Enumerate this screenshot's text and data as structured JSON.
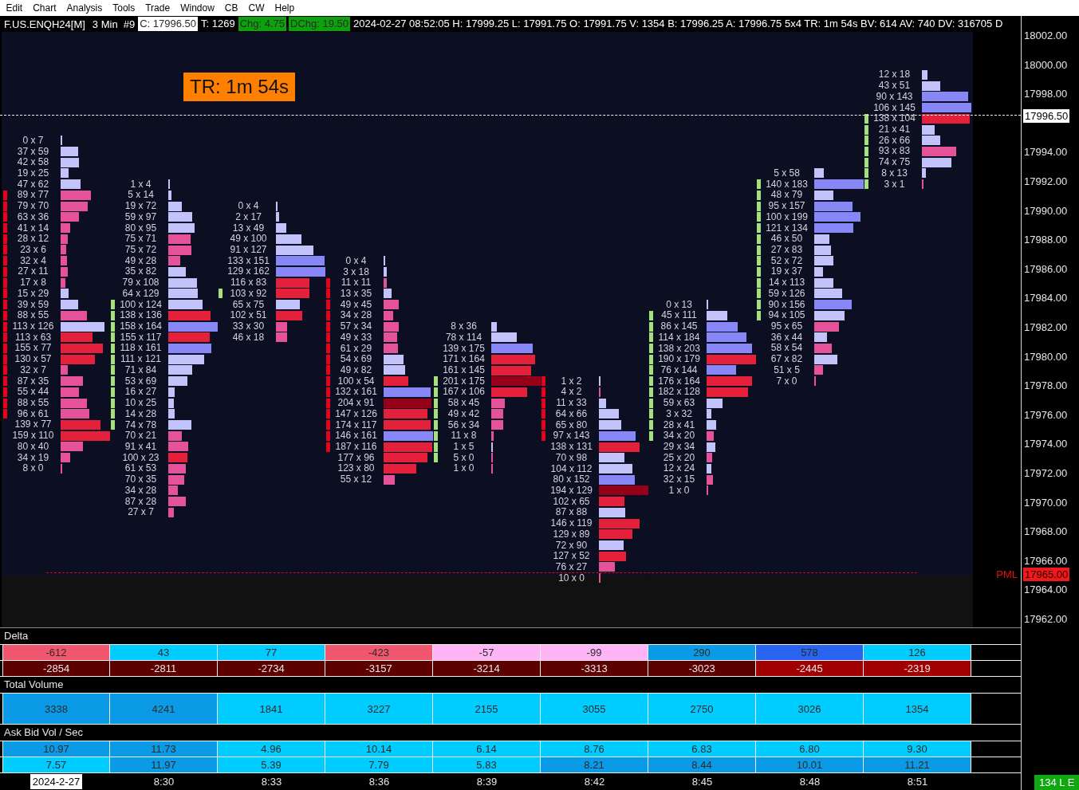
{
  "menu_bar": [
    "Edit",
    "Chart",
    "Analysis",
    "Tools",
    "Trade",
    "Window",
    "CB",
    "CW",
    "Help"
  ],
  "info_bar": {
    "symbol": "F.US.ENQH24[M]",
    "interval": "3 Min",
    "bar_number": "#9",
    "fields": [
      {
        "text": "C: 17996.50",
        "color": "#ffffff"
      },
      {
        "text": "T: 1269"
      },
      {
        "text": "Chg: 4.75",
        "color": "#0ca20c"
      },
      {
        "text": "DChg: 19.50",
        "color": "#0ca20c"
      },
      {
        "text": "2024-02-27 08:52:05 H: 17999.25 L: 17991.75 O: 17991.75 V: 1354 B: 17996.25 A: 17996.75 5x4 TR: 1m 54s BV: 614 AV: 740 DV: 316705 D"
      }
    ]
  },
  "timer_badge": "TR: 1m 54s",
  "footprint_columns": [
    {
      "rows": [
        {
          "text": "0 x 7",
          "color": "#c3c3fb",
          "level": 0.03
        },
        {
          "text": "37 x 59",
          "color": "#c3c3fb",
          "level": 0.36
        },
        {
          "text": "42 x 58",
          "color": "#c3c3fb",
          "level": 0.37
        },
        {
          "text": "19 x 25",
          "color": "#c3c3fb",
          "level": 0.16
        },
        {
          "text": "47 x 62",
          "color": "#c3c3fb",
          "level": 0.41
        },
        {
          "text": "89 x 77",
          "color": "#e6529a",
          "level": 0.62,
          "strip": {
            "color": "#e8001c"
          }
        },
        {
          "text": "79 x 70",
          "color": "#e6529a",
          "level": 0.55,
          "strip": {
            "color": "#e8001c"
          }
        },
        {
          "text": "63 x 36",
          "color": "#e6529a",
          "level": 0.37,
          "strip": {
            "color": "#e8001c"
          }
        },
        {
          "text": "41 x 14",
          "color": "#e6529a",
          "level": 0.2,
          "strip": {
            "color": "#e8001c"
          }
        },
        {
          "text": "28 x 12",
          "color": "#e6529a",
          "level": 0.15,
          "strip": {
            "color": "#e8001c"
          }
        },
        {
          "text": "23 x 6",
          "color": "#e6529a",
          "level": 0.11,
          "strip": {
            "color": "#e8001c"
          }
        },
        {
          "text": "32 x 4",
          "color": "#e6529a",
          "level": 0.13,
          "strip": {
            "color": "#e8001c"
          }
        },
        {
          "text": "27 x 11",
          "color": "#e6529a",
          "level": 0.14,
          "strip": {
            "color": "#e8001c"
          }
        },
        {
          "text": "17 x 8",
          "color": "#e6529a",
          "level": 0.09,
          "strip": {
            "color": "#e8001c"
          }
        },
        {
          "text": "15 x 29",
          "color": "#c3c3fb",
          "level": 0.16,
          "strip": {
            "color": "#e8001c"
          }
        },
        {
          "text": "39 x 59",
          "color": "#c3c3fb",
          "level": 0.36,
          "strip": {
            "color": "#e8001c"
          }
        },
        {
          "text": "88 x 55",
          "color": "#e6529a",
          "level": 0.53,
          "strip": {
            "color": "#e8001c"
          }
        },
        {
          "text": "113 x 126",
          "color": "#c3c3fb",
          "level": 0.89,
          "strip": {
            "color": "#e8001c"
          }
        },
        {
          "text": "113 x 63",
          "color": "#e5203a",
          "level": 0.65,
          "strip": {
            "color": "#e8001c"
          }
        },
        {
          "text": "155 x 77",
          "color": "#e5203a",
          "level": 0.86,
          "strip": {
            "color": "#e8001c"
          }
        },
        {
          "text": "130 x 57",
          "color": "#e5203a",
          "level": 0.7,
          "strip": {
            "color": "#e8001c"
          }
        },
        {
          "text": "32 x 7",
          "color": "#e6529a",
          "level": 0.14,
          "strip": {
            "color": "#e8001c"
          }
        },
        {
          "text": "87 x 35",
          "color": "#e6529a",
          "level": 0.45,
          "strip": {
            "color": "#e8001c"
          }
        },
        {
          "text": "55 x 44",
          "color": "#e6529a",
          "level": 0.37,
          "strip": {
            "color": "#e8001c"
          }
        },
        {
          "text": "88 x 55",
          "color": "#e6529a",
          "level": 0.53,
          "strip": {
            "color": "#e8001c"
          }
        },
        {
          "text": "96 x 61",
          "color": "#e6529a",
          "level": 0.58,
          "strip": {
            "color": "#e8001c"
          }
        },
        {
          "text": "139 x 77",
          "color": "#e5203a",
          "level": 0.8
        },
        {
          "text": "159 x 110",
          "color": "#e5203a",
          "level": 1.0
        },
        {
          "text": "80 x 40",
          "color": "#e6529a",
          "level": 0.45
        },
        {
          "text": "34 x 19",
          "color": "#e6529a",
          "level": 0.2
        },
        {
          "text": "8 x 0",
          "color": "#e6529a",
          "level": 0.03
        }
      ]
    },
    {
      "rows": [
        {
          "text": "1 x 4",
          "color": "#c3c3fb",
          "level": 0.02
        },
        {
          "text": "5 x 14",
          "color": "#c3c3fb",
          "level": 0.06
        },
        {
          "text": "19 x 72",
          "color": "#c3c3fb",
          "level": 0.28
        },
        {
          "text": "59 x 97",
          "color": "#c3c3fb",
          "level": 0.48
        },
        {
          "text": "80 x 95",
          "color": "#c3c3fb",
          "level": 0.54
        },
        {
          "text": "75 x 71",
          "color": "#e6529a",
          "level": 0.45
        },
        {
          "text": "75 x 72",
          "color": "#e6529a",
          "level": 0.46
        },
        {
          "text": "49 x 28",
          "color": "#e6529a",
          "level": 0.24
        },
        {
          "text": "35 x 82",
          "color": "#c3c3fb",
          "level": 0.36
        },
        {
          "text": "79 x 108",
          "color": "#c3c3fb",
          "level": 0.58
        },
        {
          "text": "64 x 129",
          "color": "#c3c3fb",
          "level": 0.6
        },
        {
          "text": "100 x 124",
          "color": "#c3c3fb",
          "level": 0.7,
          "strip": {
            "color": "#a4e07c"
          }
        },
        {
          "text": "138 x 136",
          "color": "#e5203a",
          "level": 0.85,
          "strip": {
            "color": "#a4e07c"
          }
        },
        {
          "text": "158 x 164",
          "color": "#8787f7",
          "level": 1.0,
          "strip": {
            "color": "#a4e07c"
          }
        },
        {
          "text": "155 x 117",
          "color": "#e5203a",
          "level": 0.84,
          "strip": {
            "color": "#a4e07c"
          }
        },
        {
          "text": "118 x 161",
          "color": "#8787f7",
          "level": 0.87,
          "strip": {
            "color": "#a4e07c"
          }
        },
        {
          "text": "111 x 121",
          "color": "#c3c3fb",
          "level": 0.72,
          "strip": {
            "color": "#a4e07c"
          }
        },
        {
          "text": "71 x 84",
          "color": "#c3c3fb",
          "level": 0.48,
          "strip": {
            "color": "#a4e07c"
          }
        },
        {
          "text": "53 x 69",
          "color": "#c3c3fb",
          "level": 0.38,
          "strip": {
            "color": "#a4e07c"
          }
        },
        {
          "text": "16 x 27",
          "color": "#c3c3fb",
          "level": 0.13,
          "strip": {
            "color": "#a4e07c"
          }
        },
        {
          "text": "10 x 25",
          "color": "#c3c3fb",
          "level": 0.11,
          "strip": {
            "color": "#a4e07c"
          }
        },
        {
          "text": "14 x 28",
          "color": "#c3c3fb",
          "level": 0.13,
          "strip": {
            "color": "#a4e07c"
          }
        },
        {
          "text": "74 x 78",
          "color": "#c3c3fb",
          "level": 0.47,
          "strip": {
            "color": "#a4e07c"
          }
        },
        {
          "text": "70 x 21",
          "color": "#e6529a",
          "level": 0.28
        },
        {
          "text": "91 x 41",
          "color": "#e6529a",
          "level": 0.41
        },
        {
          "text": "100 x 23",
          "color": "#e5203a",
          "level": 0.38
        },
        {
          "text": "61 x 53",
          "color": "#e6529a",
          "level": 0.35
        },
        {
          "text": "70 x 35",
          "color": "#e6529a",
          "level": 0.33
        },
        {
          "text": "34 x 28",
          "color": "#e6529a",
          "level": 0.19
        },
        {
          "text": "87 x 28",
          "color": "#e6529a",
          "level": 0.36
        },
        {
          "text": "27 x 7",
          "color": "#e6529a",
          "level": 0.11
        }
      ]
    },
    {
      "rows": [
        {
          "text": "0 x 4",
          "color": "#c3c3fb",
          "level": 0.01
        },
        {
          "text": "2 x 17",
          "color": "#c3c3fb",
          "level": 0.07
        },
        {
          "text": "13 x 49",
          "color": "#c3c3fb",
          "level": 0.21
        },
        {
          "text": "49 x 100",
          "color": "#c3c3fb",
          "level": 0.51
        },
        {
          "text": "91 x 127",
          "color": "#c3c3fb",
          "level": 0.75
        },
        {
          "text": "133 x 151",
          "color": "#8787f7",
          "level": 0.98
        },
        {
          "text": "129 x 162",
          "color": "#8787f7",
          "level": 1.0
        },
        {
          "text": "116 x 83",
          "color": "#e5203a",
          "level": 0.68
        },
        {
          "text": "103 x 92",
          "color": "#e5203a",
          "level": 0.67,
          "strip": {
            "color": "#a4e07c"
          }
        },
        {
          "text": "65 x 75",
          "color": "#c3c3fb",
          "level": 0.48
        },
        {
          "text": "102 x 51",
          "color": "#e5203a",
          "level": 0.53
        },
        {
          "text": "33 x 30",
          "color": "#e6529a",
          "level": 0.22
        },
        {
          "text": "46 x 18",
          "color": "#e6529a",
          "level": 0.22
        }
      ]
    },
    {
      "rows": [
        {
          "text": "0 x 4",
          "color": "#c3c3fb",
          "level": 0.01
        },
        {
          "text": "3 x 18",
          "color": "#c3c3fb",
          "level": 0.07
        },
        {
          "text": "11 x 11",
          "color": "#e6529a",
          "level": 0.07,
          "strip": {
            "color": "#e8001c"
          }
        },
        {
          "text": "13 x 35",
          "color": "#c3c3fb",
          "level": 0.16,
          "strip": {
            "color": "#e8001c"
          }
        },
        {
          "text": "49 x 45",
          "color": "#e6529a",
          "level": 0.31,
          "strip": {
            "color": "#e8001c"
          }
        },
        {
          "text": "34 x 28",
          "color": "#e6529a",
          "level": 0.2,
          "strip": {
            "color": "#e8001c"
          }
        },
        {
          "text": "57 x 34",
          "color": "#e6529a",
          "level": 0.3,
          "strip": {
            "color": "#e8001c"
          }
        },
        {
          "text": "49 x 33",
          "color": "#e6529a",
          "level": 0.27,
          "strip": {
            "color": "#e8001c"
          }
        },
        {
          "text": "61 x 29",
          "color": "#e6529a",
          "level": 0.29,
          "strip": {
            "color": "#e8001c"
          }
        },
        {
          "text": "54 x 69",
          "color": "#c3c3fb",
          "level": 0.4,
          "strip": {
            "color": "#e8001c"
          }
        },
        {
          "text": "49 x 82",
          "color": "#c3c3fb",
          "level": 0.43,
          "strip": {
            "color": "#e8001c"
          }
        },
        {
          "text": "100 x 54",
          "color": "#e5203a",
          "level": 0.5,
          "strip": {
            "color": "#e8001c"
          }
        },
        {
          "text": "132 x 161",
          "color": "#8787f7",
          "level": 0.95,
          "strip": {
            "color": "#e8001c"
          }
        },
        {
          "text": "204 x 91",
          "color": "#960018",
          "level": 0.96,
          "strip": {
            "color": "#e8001c"
          }
        },
        {
          "text": "147 x 126",
          "color": "#e5203a",
          "level": 0.89,
          "strip": {
            "color": "#e8001c"
          }
        },
        {
          "text": "174 x 117",
          "color": "#e5203a",
          "level": 0.95,
          "strip": {
            "color": "#e8001c"
          }
        },
        {
          "text": "146 x 161",
          "color": "#8787f7",
          "level": 1.0,
          "strip": {
            "color": "#e8001c"
          }
        },
        {
          "text": "187 x 116",
          "color": "#e5203a",
          "level": 0.99,
          "strip": {
            "color": "#e8001c"
          }
        },
        {
          "text": "177 x 96",
          "color": "#e5203a",
          "level": 0.89
        },
        {
          "text": "123 x 80",
          "color": "#e5203a",
          "level": 0.66
        },
        {
          "text": "55 x 12",
          "color": "#e6529a",
          "level": 0.22
        }
      ]
    },
    {
      "rows": [
        {
          "text": "8 x 36",
          "color": "#c3c3fb",
          "level": 0.12
        },
        {
          "text": "78 x 114",
          "color": "#c3c3fb",
          "level": 0.51
        },
        {
          "text": "139 x 175",
          "color": "#8787f7",
          "level": 0.84
        },
        {
          "text": "171 x 164",
          "color": "#e5203a",
          "level": 0.89
        },
        {
          "text": "161 x 145",
          "color": "#e5203a",
          "level": 0.81
        },
        {
          "text": "201 x 175",
          "color": "#960018",
          "level": 1.0,
          "strip": {
            "color": "#a4e07c"
          }
        },
        {
          "text": "167 x 106",
          "color": "#e5203a",
          "level": 0.73,
          "strip": {
            "color": "#a4e07c"
          }
        },
        {
          "text": "58 x 45",
          "color": "#e6529a",
          "level": 0.27,
          "strip": {
            "color": "#a4e07c"
          }
        },
        {
          "text": "49 x 42",
          "color": "#e6529a",
          "level": 0.24,
          "strip": {
            "color": "#a4e07c"
          }
        },
        {
          "text": "56 x 34",
          "color": "#e6529a",
          "level": 0.24,
          "strip": {
            "color": "#a4e07c"
          }
        },
        {
          "text": "11 x 8",
          "color": "#e6529a",
          "level": 0.05,
          "strip": {
            "color": "#a4e07c"
          }
        },
        {
          "text": "1 x 5",
          "color": "#c3c3fb",
          "level": 0.02,
          "strip": {
            "color": "#a4e07c"
          }
        },
        {
          "text": "5 x 0",
          "color": "#e6529a",
          "level": 0.01,
          "strip": {
            "color": "#a4e07c"
          }
        },
        {
          "text": "1 x 0",
          "color": "#e6529a",
          "level": 0.01
        }
      ]
    },
    {
      "rows": [
        {
          "text": "1 x 2",
          "color": "#c3c3fb",
          "level": 0.01,
          "strip": {
            "color": "#e8001c"
          }
        },
        {
          "text": "4 x 2",
          "color": "#e6529a",
          "level": 0.02,
          "strip": {
            "color": "#e8001c"
          }
        },
        {
          "text": "11 x 33",
          "color": "#c3c3fb",
          "level": 0.14,
          "strip": {
            "color": "#e8001c"
          }
        },
        {
          "text": "64 x 66",
          "color": "#c3c3fb",
          "level": 0.4,
          "strip": {
            "color": "#e8001c"
          }
        },
        {
          "text": "65 x 80",
          "color": "#c3c3fb",
          "level": 0.45,
          "strip": {
            "color": "#e8001c"
          }
        },
        {
          "text": "97 x 143",
          "color": "#8787f7",
          "level": 0.74,
          "strip": {
            "color": "#e8001c"
          }
        },
        {
          "text": "138 x 131",
          "color": "#e5203a",
          "level": 0.83
        },
        {
          "text": "70 x 98",
          "color": "#c3c3fb",
          "level": 0.52
        },
        {
          "text": "104 x 112",
          "color": "#c3c3fb",
          "level": 0.67
        },
        {
          "text": "80 x 152",
          "color": "#8787f7",
          "level": 0.72
        },
        {
          "text": "194 x 129",
          "color": "#960018",
          "level": 1.0
        },
        {
          "text": "102 x 65",
          "color": "#e5203a",
          "level": 0.52
        },
        {
          "text": "87 x 88",
          "color": "#c3c3fb",
          "level": 0.54
        },
        {
          "text": "146 x 119",
          "color": "#e5203a",
          "level": 0.82
        },
        {
          "text": "129 x 89",
          "color": "#e5203a",
          "level": 0.67
        },
        {
          "text": "72 x 90",
          "color": "#c3c3fb",
          "level": 0.5
        },
        {
          "text": "127 x 52",
          "color": "#e5203a",
          "level": 0.55
        },
        {
          "text": "76 x 27",
          "color": "#e6529a",
          "level": 0.32
        },
        {
          "text": "10 x 0",
          "color": "#e6529a",
          "level": 0.03
        }
      ]
    },
    {
      "rows": [
        {
          "text": "0 x 13",
          "color": "#c3c3fb",
          "level": 0.04
        },
        {
          "text": "45 x 111",
          "color": "#c3c3fb",
          "level": 0.42,
          "strip": {
            "color": "#a4e07c"
          }
        },
        {
          "text": "86 x 145",
          "color": "#8787f7",
          "level": 0.63,
          "strip": {
            "color": "#a4e07c"
          }
        },
        {
          "text": "114 x 184",
          "color": "#8787f7",
          "level": 0.81,
          "strip": {
            "color": "#a4e07c"
          }
        },
        {
          "text": "138 x 203",
          "color": "#8787f7",
          "level": 0.92,
          "strip": {
            "color": "#a4e07c"
          }
        },
        {
          "text": "190 x 179",
          "color": "#e5203a",
          "level": 1.0,
          "strip": {
            "color": "#a4e07c"
          }
        },
        {
          "text": "76 x 144",
          "color": "#8787f7",
          "level": 0.6,
          "strip": {
            "color": "#a4e07c"
          }
        },
        {
          "text": "176 x 164",
          "color": "#e5203a",
          "level": 0.92,
          "strip": {
            "color": "#a4e07c"
          }
        },
        {
          "text": "182 x 128",
          "color": "#e5203a",
          "level": 0.84,
          "strip": {
            "color": "#a4e07c"
          }
        },
        {
          "text": "59 x 63",
          "color": "#c3c3fb",
          "level": 0.33,
          "strip": {
            "color": "#a4e07c"
          }
        },
        {
          "text": "3 x 32",
          "color": "#c3c3fb",
          "level": 0.09,
          "strip": {
            "color": "#a4e07c"
          }
        },
        {
          "text": "28 x 41",
          "color": "#c3c3fb",
          "level": 0.19,
          "strip": {
            "color": "#a4e07c"
          }
        },
        {
          "text": "34 x 20",
          "color": "#e6529a",
          "level": 0.15,
          "strip": {
            "color": "#a4e07c"
          }
        },
        {
          "text": "29 x 34",
          "color": "#c3c3fb",
          "level": 0.17
        },
        {
          "text": "25 x 20",
          "color": "#e6529a",
          "level": 0.12
        },
        {
          "text": "12 x 24",
          "color": "#c3c3fb",
          "level": 0.1
        },
        {
          "text": "32 x 15",
          "color": "#e6529a",
          "level": 0.13
        },
        {
          "text": "1 x 0",
          "color": "#e6529a",
          "level": 0.01
        }
      ]
    },
    {
      "rows": [
        {
          "text": "5 x 58",
          "color": "#c3c3fb",
          "level": 0.2
        },
        {
          "text": "140 x 183",
          "color": "#8787f7",
          "level": 1.0,
          "strip": {
            "color": "#a4e07c"
          }
        },
        {
          "text": "48 x 79",
          "color": "#c3c3fb",
          "level": 0.39,
          "strip": {
            "color": "#a4e07c"
          }
        },
        {
          "text": "95 x 157",
          "color": "#8787f7",
          "level": 0.78,
          "strip": {
            "color": "#a4e07c"
          }
        },
        {
          "text": "100 x 199",
          "color": "#8787f7",
          "level": 0.93,
          "strip": {
            "color": "#a4e07c"
          }
        },
        {
          "text": "121 x 134",
          "color": "#8787f7",
          "level": 0.79,
          "strip": {
            "color": "#a4e07c"
          }
        },
        {
          "text": "46 x 50",
          "color": "#c3c3fb",
          "level": 0.3,
          "strip": {
            "color": "#a4e07c"
          }
        },
        {
          "text": "27 x 83",
          "color": "#c3c3fb",
          "level": 0.34,
          "strip": {
            "color": "#a4e07c"
          }
        },
        {
          "text": "52 x 72",
          "color": "#c3c3fb",
          "level": 0.38,
          "strip": {
            "color": "#a4e07c"
          }
        },
        {
          "text": "19 x 37",
          "color": "#c3c3fb",
          "level": 0.17,
          "strip": {
            "color": "#a4e07c"
          }
        },
        {
          "text": "14 x 113",
          "color": "#c3c3fb",
          "level": 0.39,
          "strip": {
            "color": "#a4e07c"
          }
        },
        {
          "text": "59 x 126",
          "color": "#c3c3fb",
          "level": 0.57,
          "strip": {
            "color": "#a4e07c"
          }
        },
        {
          "text": "90 x 156",
          "color": "#8787f7",
          "level": 0.76,
          "strip": {
            "color": "#a4e07c"
          }
        },
        {
          "text": "94 x 105",
          "color": "#c3c3fb",
          "level": 0.62,
          "strip": {
            "color": "#a4e07c"
          }
        },
        {
          "text": "95 x 65",
          "color": "#e6529a",
          "level": 0.5
        },
        {
          "text": "36 x 44",
          "color": "#c3c3fb",
          "level": 0.25
        },
        {
          "text": "58 x 54",
          "color": "#e6529a",
          "level": 0.35
        },
        {
          "text": "67 x 82",
          "color": "#c3c3fb",
          "level": 0.46
        },
        {
          "text": "51 x 5",
          "color": "#e6529a",
          "level": 0.17
        },
        {
          "text": "7 x 0",
          "color": "#e6529a",
          "level": 0.02
        }
      ]
    },
    {
      "rows": [
        {
          "text": "12 x 18",
          "color": "#c3c3fb",
          "level": 0.12
        },
        {
          "text": "43 x 51",
          "color": "#c3c3fb",
          "level": 0.37
        },
        {
          "text": "90 x 143",
          "color": "#8787f7",
          "level": 0.93
        },
        {
          "text": "106 x 145",
          "color": "#8787f7",
          "level": 1.0
        },
        {
          "text": "138 x 104",
          "color": "#e5203a",
          "level": 0.96,
          "strip": {
            "color": "#a4e07c"
          }
        },
        {
          "text": "21 x 41",
          "color": "#c3c3fb",
          "level": 0.25,
          "strip": {
            "color": "#a4e07c"
          }
        },
        {
          "text": "26 x 66",
          "color": "#c3c3fb",
          "level": 0.37,
          "strip": {
            "color": "#a4e07c"
          }
        },
        {
          "text": "93 x 83",
          "color": "#e6529a",
          "level": 0.7,
          "strip": {
            "color": "#a4e07c"
          }
        },
        {
          "text": "74 x 75",
          "color": "#c3c3fb",
          "level": 0.59,
          "strip": {
            "color": "#a4e07c"
          }
        },
        {
          "text": "8 x 13",
          "color": "#c3c3fb",
          "level": 0.08,
          "strip": {
            "color": "#a4e07c"
          }
        },
        {
          "text": "3 x 1",
          "color": "#e6529a",
          "level": 0.02,
          "strip": {
            "color": "#a4e07c"
          }
        }
      ]
    }
  ],
  "last_price_tag": "17996.50",
  "pml_label": "PML",
  "pml_price_tag": "17965.00",
  "price_axis": [
    "18002.00",
    "18000.00",
    "17998.00",
    "17994.00",
    "17992.00",
    "17990.00",
    "17988.00",
    "17986.00",
    "17984.00",
    "17982.00",
    "17980.00",
    "17978.00",
    "17976.00",
    "17974.00",
    "17972.00",
    "17970.00",
    "17968.00",
    "17966.00",
    "17964.00",
    "17962.00"
  ],
  "delta": {
    "title": "Delta",
    "rows": [
      [
        {
          "text": "-612",
          "color": "#f0566e"
        },
        {
          "text": "43",
          "color": "#00ccff"
        },
        {
          "text": "77",
          "color": "#00ccff"
        },
        {
          "text": "-423",
          "color": "#f0566e"
        },
        {
          "text": "-57",
          "color": "#ffb4f6"
        },
        {
          "text": "-99",
          "color": "#ffb4f6"
        },
        {
          "text": "290",
          "color": "#0a9ae6"
        },
        {
          "text": "578",
          "color": "#2864f0"
        },
        {
          "text": "126",
          "color": "#00ccff"
        }
      ],
      [
        {
          "text": "-2854",
          "color": "#5c0000"
        },
        {
          "text": "-2811",
          "color": "#5c0000"
        },
        {
          "text": "-2734",
          "color": "#5c0000"
        },
        {
          "text": "-3157",
          "color": "#5c0000"
        },
        {
          "text": "-3214",
          "color": "#5c0000"
        },
        {
          "text": "-3313",
          "color": "#5c0000"
        },
        {
          "text": "-3023",
          "color": "#5c0000"
        },
        {
          "text": "-2445",
          "color": "#a00000"
        },
        {
          "text": "-2319",
          "color": "#a00000"
        }
      ]
    ]
  },
  "total_volume": {
    "title": "Total Volume",
    "rows": [
      [
        {
          "text": "3338",
          "color": "#0a9ae6"
        },
        {
          "text": "4241",
          "color": "#0a9ae6"
        },
        {
          "text": "1841",
          "color": "#00ccff"
        },
        {
          "text": "3227",
          "color": "#00ccff"
        },
        {
          "text": "2155",
          "color": "#00ccff"
        },
        {
          "text": "3055",
          "color": "#00ccff"
        },
        {
          "text": "2750",
          "color": "#00ccff"
        },
        {
          "text": "3026",
          "color": "#00ccff"
        },
        {
          "text": "1354",
          "color": "#00ccff"
        }
      ]
    ]
  },
  "ask_bid_vol_sec": {
    "title": "Ask Bid Vol / Sec",
    "rows": [
      [
        {
          "text": "10.97",
          "color": "#0a9ae6"
        },
        {
          "text": "11.73",
          "color": "#0a9ae6"
        },
        {
          "text": "4.96",
          "color": "#00ccff"
        },
        {
          "text": "10.14",
          "color": "#00ccff"
        },
        {
          "text": "6.14",
          "color": "#00ccff"
        },
        {
          "text": "8.76",
          "color": "#00ccff"
        },
        {
          "text": "6.83",
          "color": "#00ccff"
        },
        {
          "text": "6.80",
          "color": "#00ccff"
        },
        {
          "text": "9.30",
          "color": "#00ccff"
        }
      ],
      [
        {
          "text": "7.57",
          "color": "#00ccff"
        },
        {
          "text": "11.97",
          "color": "#0a9ae6"
        },
        {
          "text": "5.39",
          "color": "#00ccff"
        },
        {
          "text": "7.79",
          "color": "#00ccff"
        },
        {
          "text": "5.83",
          "color": "#00ccff"
        },
        {
          "text": "8.21",
          "color": "#0a9ae6"
        },
        {
          "text": "8.44",
          "color": "#0a9ae6"
        },
        {
          "text": "10.01",
          "color": "#0a9ae6"
        },
        {
          "text": "11.21",
          "color": "#0a9ae6"
        }
      ]
    ]
  },
  "time_axis": [
    {
      "text": "2024-2-27",
      "kind": "date"
    },
    {
      "text": "8:30",
      "kind": "time"
    },
    {
      "text": "8:33",
      "kind": "time"
    },
    {
      "text": "8:36",
      "kind": "time"
    },
    {
      "text": "8:39",
      "kind": "time"
    },
    {
      "text": "8:42",
      "kind": "time"
    },
    {
      "text": "8:45",
      "kind": "time"
    },
    {
      "text": "8:48",
      "kind": "time"
    },
    {
      "text": "8:51",
      "kind": "time"
    }
  ],
  "status_badge": "134 L E"
}
